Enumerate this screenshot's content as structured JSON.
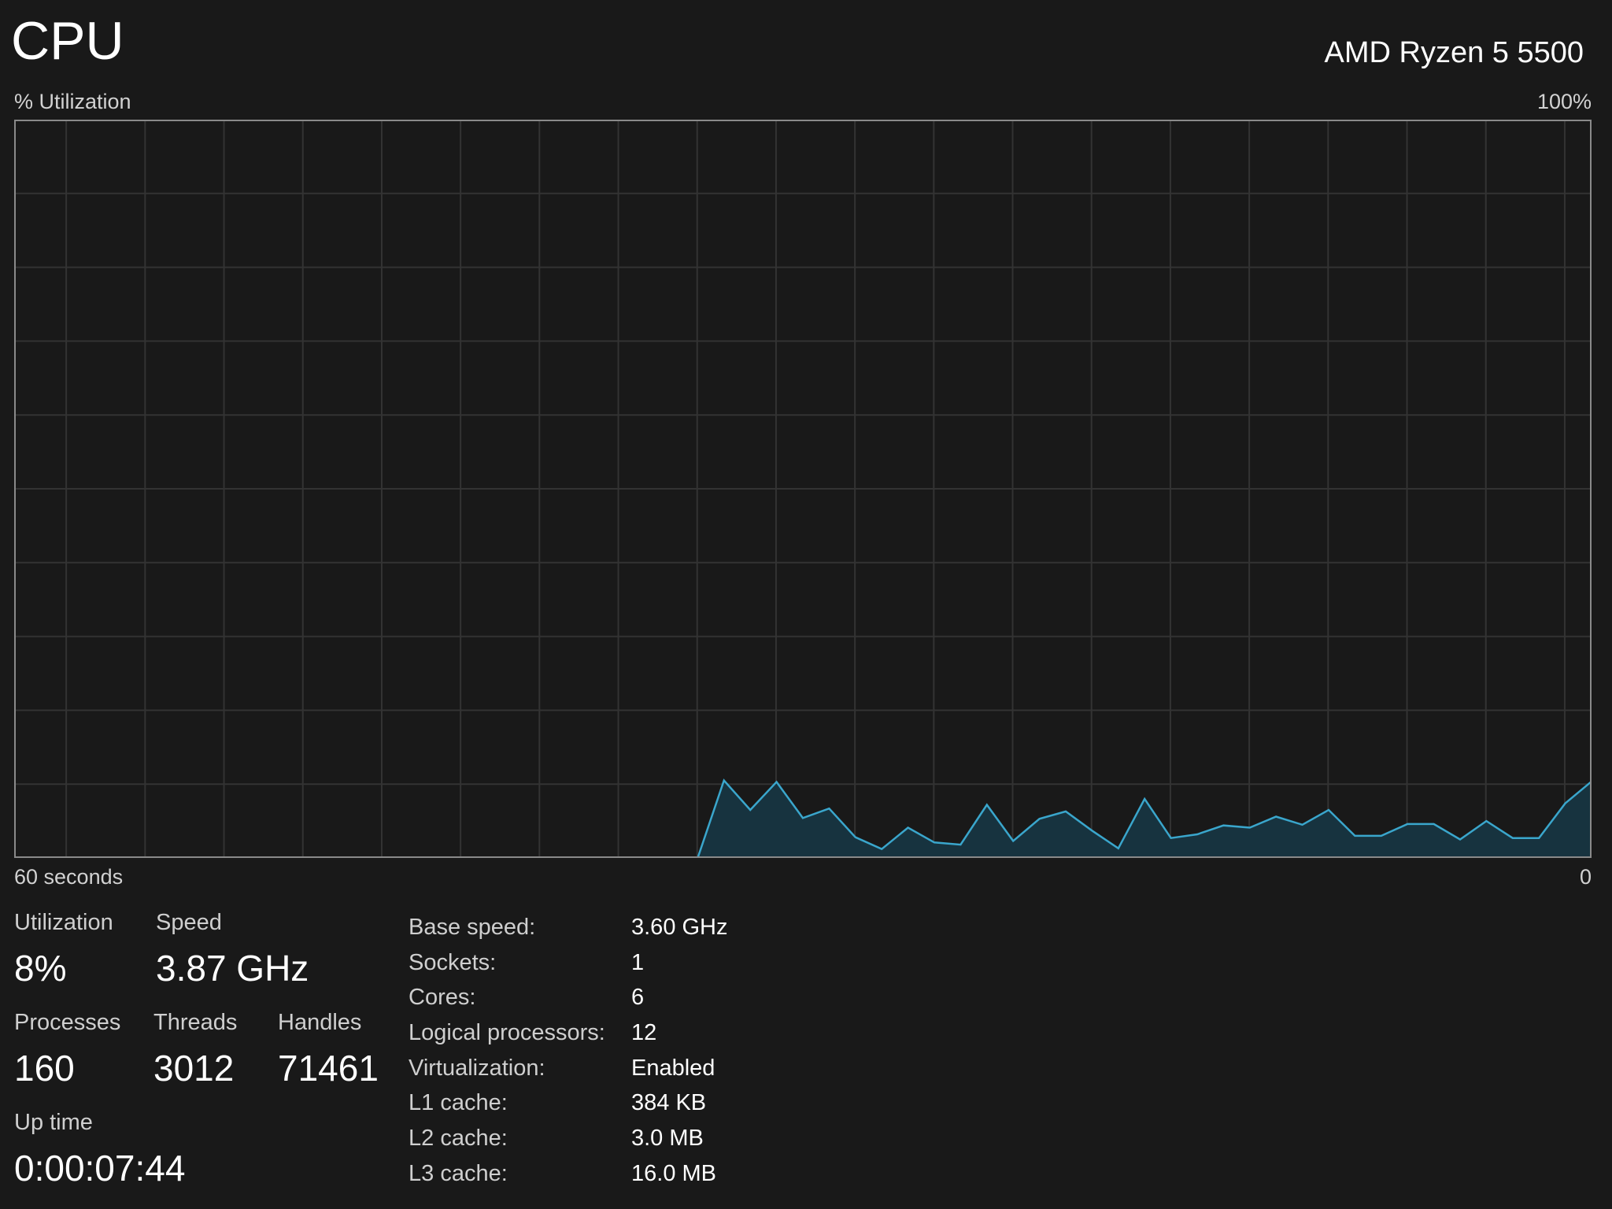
{
  "header": {
    "title": "CPU",
    "model": "AMD Ryzen 5 5500"
  },
  "graph": {
    "y_axis_label": "% Utilization",
    "y_max_label": "100%",
    "x_left_label": "60 seconds",
    "x_right_label": "0",
    "line_color": "#3aa6cc",
    "fill_color": "#17333f",
    "grid_color": "#333333",
    "border_color": "#8a8a8a"
  },
  "chart_data": {
    "type": "area",
    "x": [
      60,
      59,
      58,
      57,
      56,
      55,
      54,
      53,
      52,
      51,
      50,
      49,
      48,
      47,
      46,
      45,
      44,
      43,
      42,
      41,
      40,
      39,
      38,
      37,
      36,
      35,
      34,
      33,
      32,
      31,
      30,
      29,
      28,
      27,
      26,
      25,
      24,
      23,
      22,
      21,
      20,
      19,
      18,
      17,
      16,
      15,
      14,
      13,
      12,
      11,
      10,
      9,
      8,
      7,
      6,
      5,
      4,
      3,
      2,
      1,
      0
    ],
    "values": [
      0,
      0,
      0,
      0,
      0,
      0,
      0,
      0,
      0,
      0,
      0,
      0,
      0,
      0,
      0,
      0,
      0,
      0,
      0,
      0,
      0,
      0,
      0,
      0,
      0,
      0,
      0,
      10.5,
      6.5,
      10.3,
      5.4,
      6.7,
      2.8,
      1.2,
      4.1,
      2.1,
      1.8,
      7.2,
      2.3,
      5.3,
      6.3,
      3.7,
      1.3,
      8.0,
      2.7,
      3.2,
      4.4,
      4.1,
      5.6,
      4.5,
      6.5,
      3.0,
      3.0,
      4.6,
      4.6,
      2.5,
      5.0,
      2.7,
      2.7,
      7.4,
      null
    ],
    "xlabel": "60 seconds",
    "ylabel": "% Utilization",
    "xlim": [
      60,
      0
    ],
    "ylim": [
      0,
      100
    ],
    "grid": true
  },
  "stats": {
    "utilization": {
      "label": "Utilization",
      "value": "8%"
    },
    "speed": {
      "label": "Speed",
      "value": "3.87 GHz"
    },
    "processes": {
      "label": "Processes",
      "value": "160"
    },
    "threads": {
      "label": "Threads",
      "value": "3012"
    },
    "handles": {
      "label": "Handles",
      "value": "71461"
    },
    "uptime": {
      "label": "Up time",
      "value": "0:00:07:44"
    }
  },
  "specs": [
    {
      "key": "Base speed:",
      "value": "3.60 GHz"
    },
    {
      "key": "Sockets:",
      "value": "1"
    },
    {
      "key": "Cores:",
      "value": "6"
    },
    {
      "key": "Logical processors:",
      "value": "12"
    },
    {
      "key": "Virtualization:",
      "value": "Enabled"
    },
    {
      "key": "L1 cache:",
      "value": "384 KB"
    },
    {
      "key": "L2 cache:",
      "value": "3.0 MB"
    },
    {
      "key": "L3 cache:",
      "value": "16.0 MB"
    }
  ]
}
